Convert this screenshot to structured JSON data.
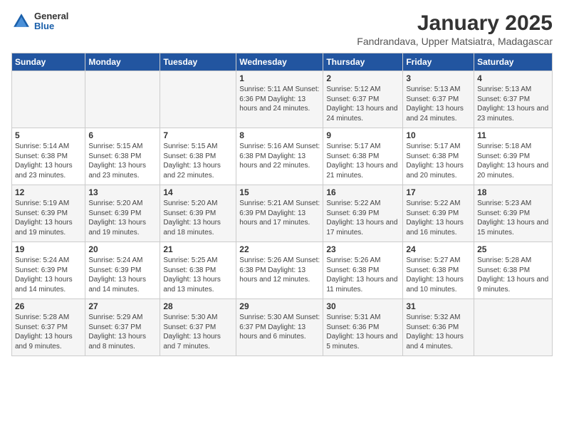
{
  "header": {
    "logo": {
      "general": "General",
      "blue": "Blue"
    },
    "title": "January 2025",
    "subtitle": "Fandrandava, Upper Matsiatra, Madagascar"
  },
  "calendar": {
    "days_of_week": [
      "Sunday",
      "Monday",
      "Tuesday",
      "Wednesday",
      "Thursday",
      "Friday",
      "Saturday"
    ],
    "weeks": [
      [
        {
          "day": "",
          "info": ""
        },
        {
          "day": "",
          "info": ""
        },
        {
          "day": "",
          "info": ""
        },
        {
          "day": "1",
          "info": "Sunrise: 5:11 AM\nSunset: 6:36 PM\nDaylight: 13 hours and 24 minutes."
        },
        {
          "day": "2",
          "info": "Sunrise: 5:12 AM\nSunset: 6:37 PM\nDaylight: 13 hours and 24 minutes."
        },
        {
          "day": "3",
          "info": "Sunrise: 5:13 AM\nSunset: 6:37 PM\nDaylight: 13 hours and 24 minutes."
        },
        {
          "day": "4",
          "info": "Sunrise: 5:13 AM\nSunset: 6:37 PM\nDaylight: 13 hours and 23 minutes."
        }
      ],
      [
        {
          "day": "5",
          "info": "Sunrise: 5:14 AM\nSunset: 6:38 PM\nDaylight: 13 hours and 23 minutes."
        },
        {
          "day": "6",
          "info": "Sunrise: 5:15 AM\nSunset: 6:38 PM\nDaylight: 13 hours and 23 minutes."
        },
        {
          "day": "7",
          "info": "Sunrise: 5:15 AM\nSunset: 6:38 PM\nDaylight: 13 hours and 22 minutes."
        },
        {
          "day": "8",
          "info": "Sunrise: 5:16 AM\nSunset: 6:38 PM\nDaylight: 13 hours and 22 minutes."
        },
        {
          "day": "9",
          "info": "Sunrise: 5:17 AM\nSunset: 6:38 PM\nDaylight: 13 hours and 21 minutes."
        },
        {
          "day": "10",
          "info": "Sunrise: 5:17 AM\nSunset: 6:38 PM\nDaylight: 13 hours and 20 minutes."
        },
        {
          "day": "11",
          "info": "Sunrise: 5:18 AM\nSunset: 6:39 PM\nDaylight: 13 hours and 20 minutes."
        }
      ],
      [
        {
          "day": "12",
          "info": "Sunrise: 5:19 AM\nSunset: 6:39 PM\nDaylight: 13 hours and 19 minutes."
        },
        {
          "day": "13",
          "info": "Sunrise: 5:20 AM\nSunset: 6:39 PM\nDaylight: 13 hours and 19 minutes."
        },
        {
          "day": "14",
          "info": "Sunrise: 5:20 AM\nSunset: 6:39 PM\nDaylight: 13 hours and 18 minutes."
        },
        {
          "day": "15",
          "info": "Sunrise: 5:21 AM\nSunset: 6:39 PM\nDaylight: 13 hours and 17 minutes."
        },
        {
          "day": "16",
          "info": "Sunrise: 5:22 AM\nSunset: 6:39 PM\nDaylight: 13 hours and 17 minutes."
        },
        {
          "day": "17",
          "info": "Sunrise: 5:22 AM\nSunset: 6:39 PM\nDaylight: 13 hours and 16 minutes."
        },
        {
          "day": "18",
          "info": "Sunrise: 5:23 AM\nSunset: 6:39 PM\nDaylight: 13 hours and 15 minutes."
        }
      ],
      [
        {
          "day": "19",
          "info": "Sunrise: 5:24 AM\nSunset: 6:39 PM\nDaylight: 13 hours and 14 minutes."
        },
        {
          "day": "20",
          "info": "Sunrise: 5:24 AM\nSunset: 6:39 PM\nDaylight: 13 hours and 14 minutes."
        },
        {
          "day": "21",
          "info": "Sunrise: 5:25 AM\nSunset: 6:38 PM\nDaylight: 13 hours and 13 minutes."
        },
        {
          "day": "22",
          "info": "Sunrise: 5:26 AM\nSunset: 6:38 PM\nDaylight: 13 hours and 12 minutes."
        },
        {
          "day": "23",
          "info": "Sunrise: 5:26 AM\nSunset: 6:38 PM\nDaylight: 13 hours and 11 minutes."
        },
        {
          "day": "24",
          "info": "Sunrise: 5:27 AM\nSunset: 6:38 PM\nDaylight: 13 hours and 10 minutes."
        },
        {
          "day": "25",
          "info": "Sunrise: 5:28 AM\nSunset: 6:38 PM\nDaylight: 13 hours and 9 minutes."
        }
      ],
      [
        {
          "day": "26",
          "info": "Sunrise: 5:28 AM\nSunset: 6:37 PM\nDaylight: 13 hours and 9 minutes."
        },
        {
          "day": "27",
          "info": "Sunrise: 5:29 AM\nSunset: 6:37 PM\nDaylight: 13 hours and 8 minutes."
        },
        {
          "day": "28",
          "info": "Sunrise: 5:30 AM\nSunset: 6:37 PM\nDaylight: 13 hours and 7 minutes."
        },
        {
          "day": "29",
          "info": "Sunrise: 5:30 AM\nSunset: 6:37 PM\nDaylight: 13 hours and 6 minutes."
        },
        {
          "day": "30",
          "info": "Sunrise: 5:31 AM\nSunset: 6:36 PM\nDaylight: 13 hours and 5 minutes."
        },
        {
          "day": "31",
          "info": "Sunrise: 5:32 AM\nSunset: 6:36 PM\nDaylight: 13 hours and 4 minutes."
        },
        {
          "day": "",
          "info": ""
        }
      ]
    ]
  }
}
